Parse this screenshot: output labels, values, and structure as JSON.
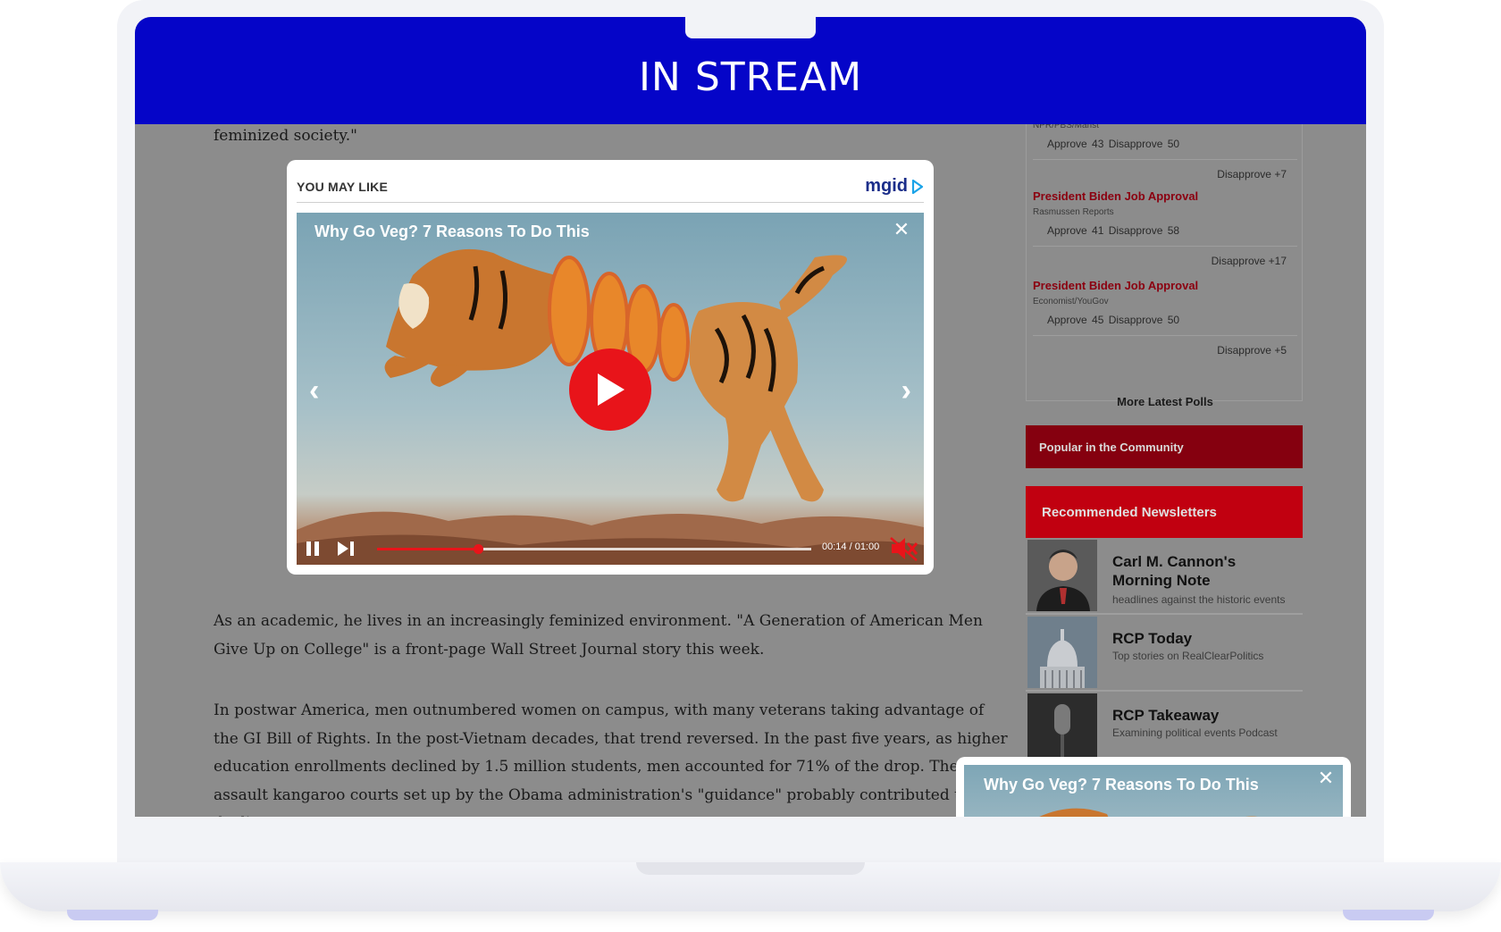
{
  "banner": {
    "title": "IN STREAM"
  },
  "article": {
    "fragment": "feminized society.\"",
    "paragraph_1": "As an academic, he lives in an increasingly feminized environment. \"A Generation of American Men Give Up on College\" is a front-page Wall Street Journal story this week.",
    "paragraph_2": "In postwar America, men outnumbered women on campus, with many veterans taking advantage of the GI Bill of Rights. In the post-Vietnam decades, that trend reversed. In the past five years, as higher education enrollments declined by 1.5 million students, men accounted for 71% of the drop. The sexual assault kangaroo courts set up by the Obama administration's \"guidance\" probably contributed to this decline."
  },
  "widget": {
    "header": "YOU MAY LIKE",
    "brand": "mgid",
    "video_title": "Why Go Veg? 7 Reasons To Do This",
    "time": "00:14 / 01:00",
    "progress": 0.233,
    "icons": {
      "close": "close-icon",
      "play": "play-icon",
      "prev": "chevron-left-icon",
      "next": "chevron-right-icon",
      "pause": "pause-icon",
      "skip": "skip-next-icon",
      "mute": "volume-muted-icon"
    },
    "accent": "#e8141a"
  },
  "polls": {
    "items": [
      {
        "title": "",
        "source": "NPR/PBS/Marist",
        "values": "Approve 43  Disapprove 50",
        "diff": "Disapprove +7"
      },
      {
        "title": "President Biden Job Approval",
        "source": "Rasmussen Reports",
        "values": "Approve 41  Disapprove 58",
        "diff": "Disapprove +17"
      },
      {
        "title": "President Biden Job Approval",
        "source": "Economist/YouGov",
        "values": "Approve 45  Disapprove 50",
        "diff": "Disapprove +5"
      }
    ],
    "more_label": "More Latest Polls"
  },
  "popular": {
    "label": "Popular in the Community"
  },
  "newsletters": {
    "header": "Recommended Newsletters",
    "items": [
      {
        "title": "Carl M. Cannon's Morning Note",
        "desc": "headlines against the historic events"
      },
      {
        "title": "RCP Today",
        "desc": "Top stories on RealClearPolitics"
      },
      {
        "title": "RCP Takeaway",
        "desc": "Examining political events Podcast"
      }
    ]
  },
  "mini_player": {
    "title": "Why Go Veg? 7 Reasons To Do This"
  },
  "colors": {
    "banner": "#0505c8",
    "brand_red": "#c10010",
    "dark_red": "#85000f"
  }
}
